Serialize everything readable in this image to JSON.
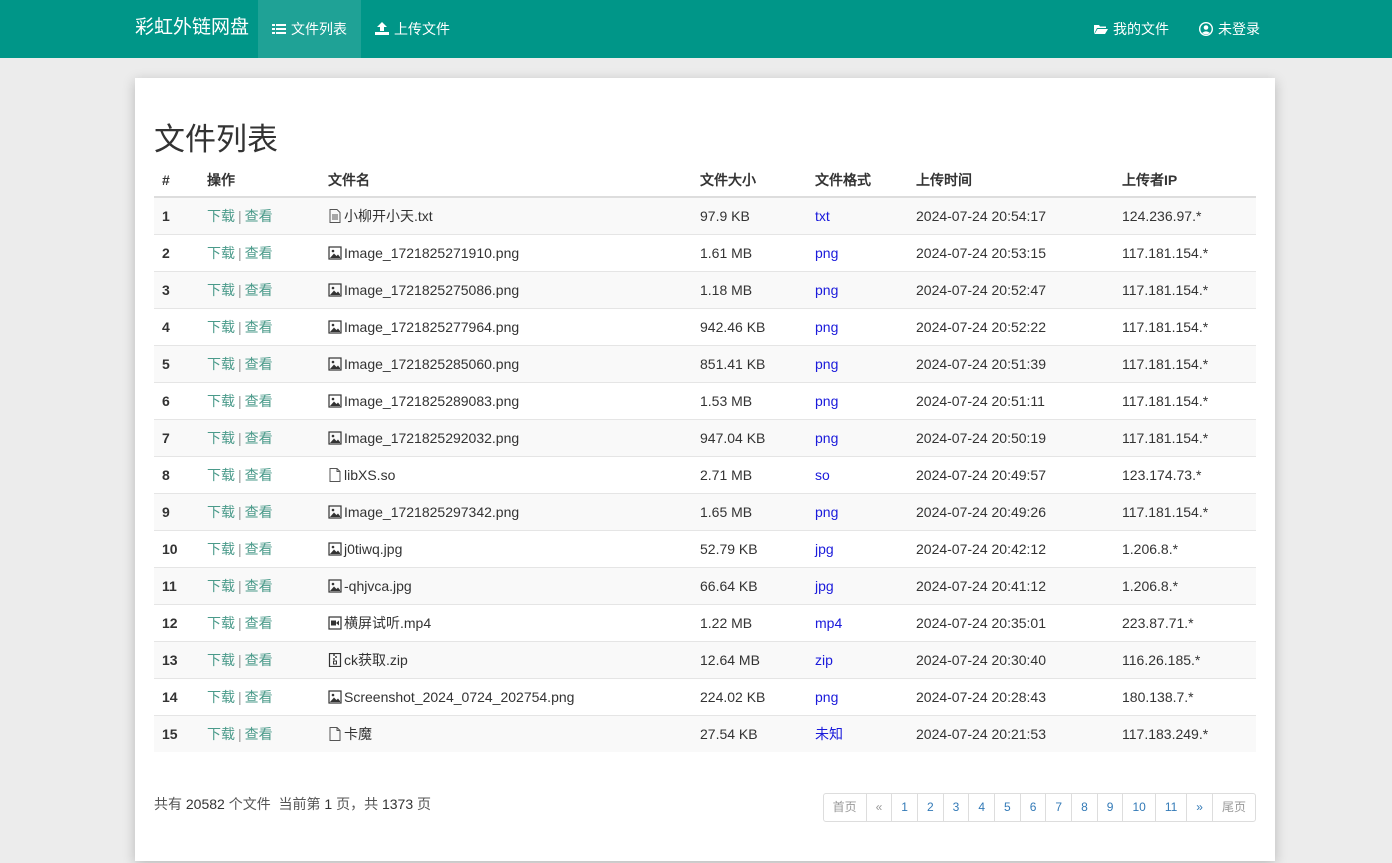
{
  "nav": {
    "brand": "彩虹外链网盘",
    "left": [
      {
        "label": "文件列表",
        "icon": "list-icon",
        "active": true
      },
      {
        "label": "上传文件",
        "icon": "upload-icon",
        "active": false
      }
    ],
    "right": [
      {
        "label": "我的文件",
        "icon": "folder-open-icon"
      },
      {
        "label": "未登录",
        "icon": "user-circle-icon"
      }
    ]
  },
  "page_title": "文件列表",
  "table": {
    "headers": [
      "#",
      "操作",
      "文件名",
      "文件大小",
      "文件格式",
      "上传时间",
      "上传者IP"
    ],
    "action_download": "下载",
    "action_view": "查看",
    "action_sep": "|",
    "rows": [
      {
        "idx": "1",
        "name": "小柳开小天.txt",
        "icon": "text-file-icon",
        "size": "97.9 KB",
        "fmt": "txt",
        "time": "2024-07-24 20:54:17",
        "ip": "124.236.97.*"
      },
      {
        "idx": "2",
        "name": "Image_1721825271910.png",
        "icon": "image-file-icon",
        "size": "1.61 MB",
        "fmt": "png",
        "time": "2024-07-24 20:53:15",
        "ip": "117.181.154.*"
      },
      {
        "idx": "3",
        "name": "Image_1721825275086.png",
        "icon": "image-file-icon",
        "size": "1.18 MB",
        "fmt": "png",
        "time": "2024-07-24 20:52:47",
        "ip": "117.181.154.*"
      },
      {
        "idx": "4",
        "name": "Image_1721825277964.png",
        "icon": "image-file-icon",
        "size": "942.46 KB",
        "fmt": "png",
        "time": "2024-07-24 20:52:22",
        "ip": "117.181.154.*"
      },
      {
        "idx": "5",
        "name": "Image_1721825285060.png",
        "icon": "image-file-icon",
        "size": "851.41 KB",
        "fmt": "png",
        "time": "2024-07-24 20:51:39",
        "ip": "117.181.154.*"
      },
      {
        "idx": "6",
        "name": "Image_1721825289083.png",
        "icon": "image-file-icon",
        "size": "1.53 MB",
        "fmt": "png",
        "time": "2024-07-24 20:51:11",
        "ip": "117.181.154.*"
      },
      {
        "idx": "7",
        "name": "Image_1721825292032.png",
        "icon": "image-file-icon",
        "size": "947.04 KB",
        "fmt": "png",
        "time": "2024-07-24 20:50:19",
        "ip": "117.181.154.*"
      },
      {
        "idx": "8",
        "name": "libXS.so",
        "icon": "file-icon",
        "size": "2.71 MB",
        "fmt": "so",
        "time": "2024-07-24 20:49:57",
        "ip": "123.174.73.*"
      },
      {
        "idx": "9",
        "name": "Image_1721825297342.png",
        "icon": "image-file-icon",
        "size": "1.65 MB",
        "fmt": "png",
        "time": "2024-07-24 20:49:26",
        "ip": "117.181.154.*"
      },
      {
        "idx": "10",
        "name": "j0tiwq.jpg",
        "icon": "image-file-icon",
        "size": "52.79 KB",
        "fmt": "jpg",
        "time": "2024-07-24 20:42:12",
        "ip": "1.206.8.*"
      },
      {
        "idx": "11",
        "name": "-qhjvca.jpg",
        "icon": "image-file-icon",
        "size": "66.64 KB",
        "fmt": "jpg",
        "time": "2024-07-24 20:41:12",
        "ip": "1.206.8.*"
      },
      {
        "idx": "12",
        "name": "横屏试听.mp4",
        "icon": "video-file-icon",
        "size": "1.22 MB",
        "fmt": "mp4",
        "time": "2024-07-24 20:35:01",
        "ip": "223.87.71.*"
      },
      {
        "idx": "13",
        "name": "ck获取.zip",
        "icon": "archive-file-icon",
        "size": "12.64 MB",
        "fmt": "zip",
        "time": "2024-07-24 20:30:40",
        "ip": "116.26.185.*"
      },
      {
        "idx": "14",
        "name": "Screenshot_2024_0724_202754.png",
        "icon": "image-file-icon",
        "size": "224.02 KB",
        "fmt": "png",
        "time": "2024-07-24 20:28:43",
        "ip": "180.138.7.*"
      },
      {
        "idx": "15",
        "name": "卡魔",
        "icon": "file-icon",
        "size": "27.54 KB",
        "fmt": "未知",
        "time": "2024-07-24 20:21:53",
        "ip": "117.183.249.*"
      }
    ]
  },
  "footer": {
    "prefix": "共有",
    "total": "20582",
    "mid": "个文件  当前第",
    "current": "1",
    "mid2": "页，共",
    "pages": "1373",
    "suffix": "页"
  },
  "pager": [
    "首页",
    "«",
    "1",
    "2",
    "3",
    "4",
    "5",
    "6",
    "7",
    "8",
    "9",
    "10",
    "11",
    "»",
    "尾页"
  ],
  "colors": {
    "navbar": "#009688",
    "link": "#4a9a8a",
    "format": "#1a1adb"
  }
}
